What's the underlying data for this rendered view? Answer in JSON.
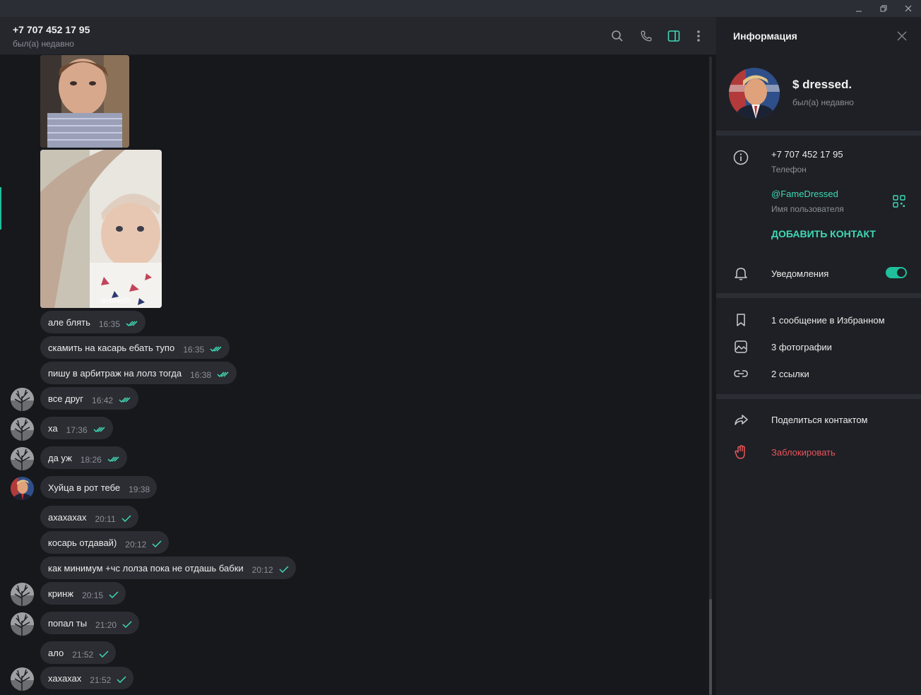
{
  "window": {
    "minimize": "–",
    "restore": "❐",
    "close": "✕"
  },
  "chat": {
    "title": "+7 707 452 17 95",
    "status": "был(а) недавно",
    "icons": [
      "search-icon",
      "phone-icon",
      "sidebar-toggle-icon",
      "more-vert-icon"
    ]
  },
  "messages": [
    {
      "text": "але блять",
      "time": "16:35",
      "checks": "double",
      "avatar": null
    },
    {
      "text": "скамить на касарь ебать тупо",
      "time": "16:35",
      "checks": "double",
      "avatar": null
    },
    {
      "text": "пишу в арбитраж на лолз тогда",
      "time": "16:38",
      "checks": "double",
      "avatar": null
    },
    {
      "text": "все друг",
      "time": "16:42",
      "checks": "double",
      "avatar": "tree"
    },
    {
      "text": "ха",
      "time": "17:36",
      "checks": "double",
      "avatar": "tree"
    },
    {
      "text": "да уж",
      "time": "18:26",
      "checks": "double",
      "avatar": "tree"
    },
    {
      "text": "Хуйца в рот тебе",
      "time": "19:38",
      "checks": "none",
      "avatar": "trump"
    },
    {
      "text": "ахахахах",
      "time": "20:11",
      "checks": "single",
      "avatar": null
    },
    {
      "text": "косарь отдавай)",
      "time": "20:12",
      "checks": "single",
      "avatar": null
    },
    {
      "text": "как минимум +чс лолза пока не отдашь бабки",
      "time": "20:12",
      "checks": "single",
      "avatar": null
    },
    {
      "text": "кринж",
      "time": "20:15",
      "checks": "single",
      "avatar": "tree"
    },
    {
      "text": "попал ты",
      "time": "21:20",
      "checks": "single",
      "avatar": "tree"
    },
    {
      "text": "ало",
      "time": "21:52",
      "checks": "single",
      "avatar": null
    },
    {
      "text": "хахахах",
      "time": "21:52",
      "checks": "single",
      "avatar": "tree"
    }
  ],
  "photo_watermark": "@alisagifs",
  "info": {
    "title": "Информация",
    "profile_name": "$ dressed.",
    "profile_status": "был(а) недавно",
    "phone": "+7 707 452 17 95",
    "phone_label": "Телефон",
    "username": "@FameDressed",
    "username_label": "Имя пользователя",
    "add_contact": "ДОБАВИТЬ КОНТАКТ",
    "notifications": "Уведомления",
    "notifications_on": true,
    "saved": "1 сообщение в Избранном",
    "photos": "3 фотографии",
    "links": "2 ссылки",
    "share": "Поделиться контактом",
    "block": "Заблокировать"
  },
  "colors": {
    "accent": "#3fd9b5",
    "danger": "#e8545a",
    "bubble": "#2b2d33",
    "panel": "#1e2025"
  }
}
